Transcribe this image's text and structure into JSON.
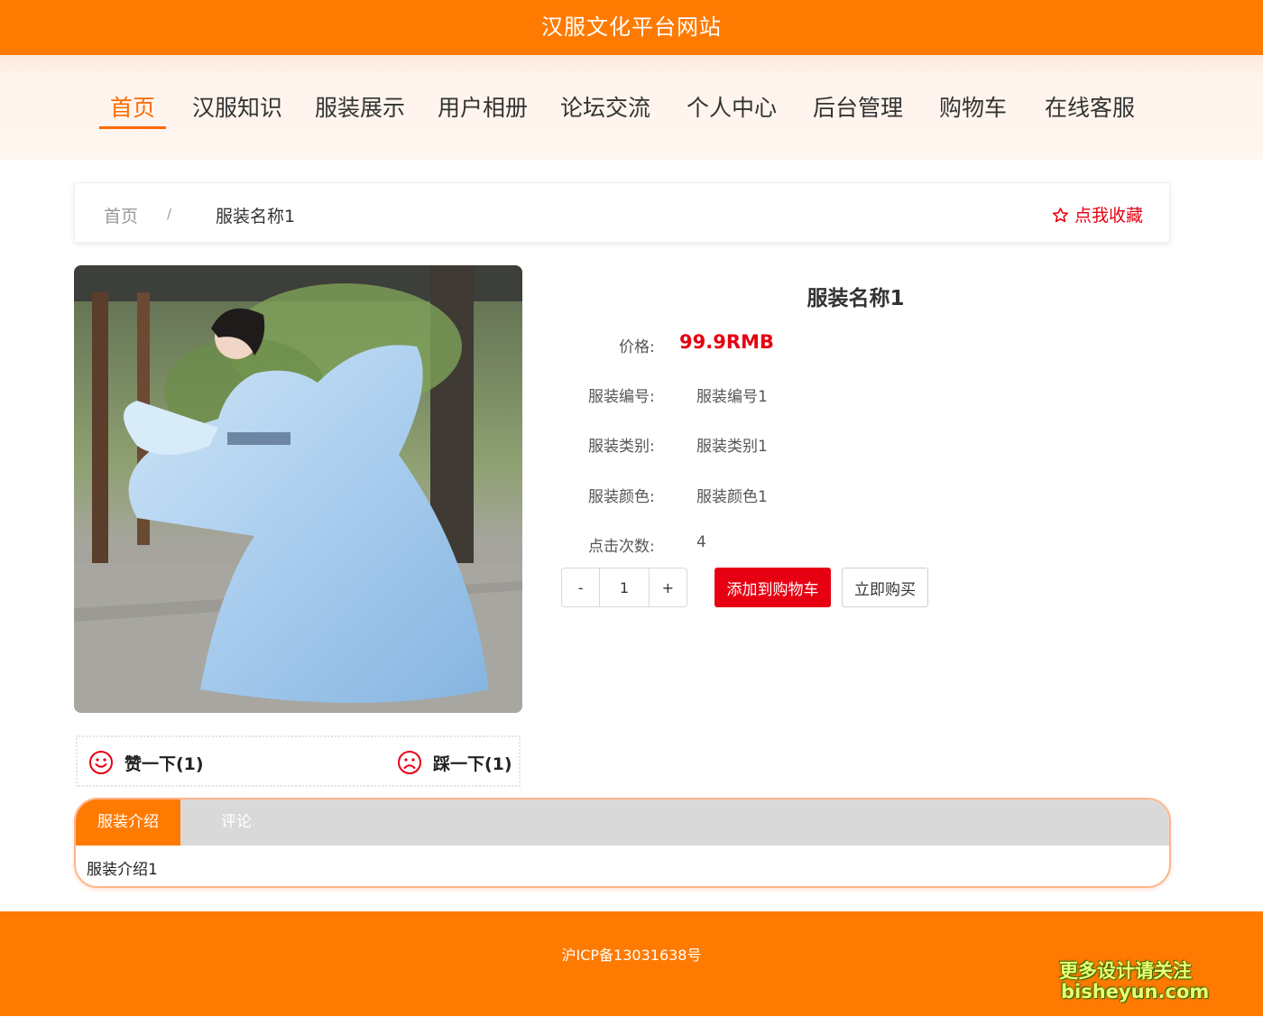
{
  "site": {
    "title": "汉服文化平台网站"
  },
  "nav": {
    "items": [
      {
        "label": "首页"
      },
      {
        "label": "汉服知识"
      },
      {
        "label": "服装展示"
      },
      {
        "label": "用户相册"
      },
      {
        "label": "论坛交流"
      },
      {
        "label": "个人中心"
      },
      {
        "label": "后台管理"
      },
      {
        "label": "购物车"
      },
      {
        "label": "在线客服"
      }
    ],
    "active_index": 0
  },
  "breadcrumb": {
    "home": "首页",
    "separator": "/",
    "current": "服装名称1",
    "favorite": "点我收藏"
  },
  "product": {
    "name": "服装名称1",
    "price_label": "价格:",
    "price": "99.9RMB",
    "fields": [
      {
        "label": "服装编号:",
        "value": "服装编号1"
      },
      {
        "label": "服装类别:",
        "value": "服装类别1"
      },
      {
        "label": "服装颜色:",
        "value": "服装颜色1"
      },
      {
        "label": "点击次数:",
        "value": "4"
      }
    ],
    "quantity": "1",
    "minus": "-",
    "plus": "+",
    "add_to_cart": "添加到购物车",
    "buy_now": "立即购买"
  },
  "votes": {
    "like": "赞一下(1)",
    "dislike": "踩一下(1)"
  },
  "tabs": {
    "items": [
      "服装介绍",
      "评论"
    ],
    "content": "服装介绍1"
  },
  "footer": {
    "icp": "沪ICP备13031638号"
  },
  "watermark": {
    "line1": "更多设计请关注",
    "line2": "bisheyun.com"
  },
  "colors": {
    "brand": "#ff7a00",
    "accent_red": "#e60012",
    "tab_inactive": "#d9d9d9"
  }
}
